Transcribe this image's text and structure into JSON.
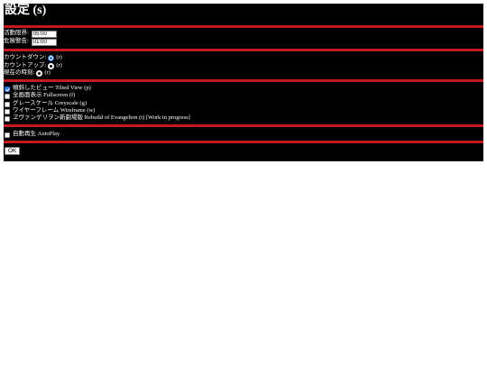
{
  "title": "設定 (s)",
  "time": {
    "activity_limit_label": "活動限界:",
    "activity_limit_value": "05:00",
    "danger_label": "危険警告:",
    "danger_value": "01:00"
  },
  "mode": {
    "countdown_label": "カウントダウン:",
    "countdown_key": "(r)",
    "countup_label": "カウントアップ:",
    "countup_key": "(r)",
    "now_label": "現在の時刻:",
    "now_key": "(r)",
    "selected": "countdown"
  },
  "options": [
    {
      "label": "傾斜したビュー Tilted View (p)",
      "checked": true
    },
    {
      "label": "全画面表示 Fullscreen (f)",
      "checked": false
    },
    {
      "label": "グレースケール Greyscale (g)",
      "checked": false
    },
    {
      "label": "ワイヤーフレーム Wireframe (w)",
      "checked": false
    },
    {
      "label": "ヱヴァンゲリヲン新劇場版 Rebuild of Evangelion (t) [Work in progress]",
      "checked": false
    }
  ],
  "autoplay": {
    "label": "自動再生 AutoPlay",
    "checked": false
  },
  "ok_label": "OK",
  "colors": {
    "panel_bg": "#000000",
    "divider": "#c41a22",
    "accent": "#2a6fdb"
  }
}
